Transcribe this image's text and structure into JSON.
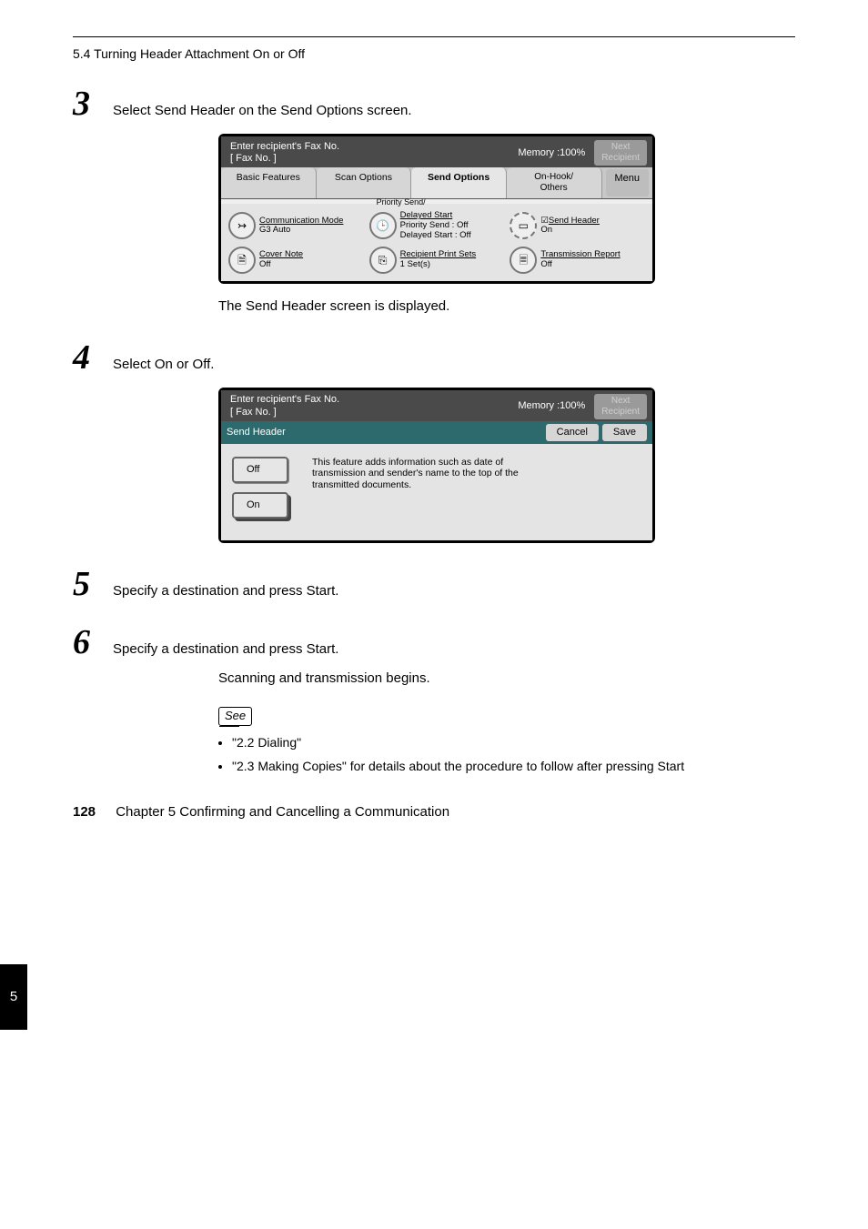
{
  "header": {
    "caption": "5.4 Turning Header Attachment On or Off"
  },
  "steps": {
    "s3": {
      "num": "3",
      "text": "Select Send Header on the Send Options screen.",
      "note": "The Send Header screen is displayed."
    },
    "s4": {
      "num": "4",
      "text": "Select On or Off."
    },
    "s5": {
      "num": "5",
      "text": "Specify a destination and press Start."
    },
    "s6": {
      "num": "6",
      "text": "Specify a destination and press Start.",
      "note": "Scanning and transmission begins."
    }
  },
  "screen1": {
    "title_line1": "Enter recipient's Fax No.",
    "title_line2": "[  Fax No. ]",
    "memory": "Memory :100%",
    "next_l1": "Next",
    "next_l2": "Recipient",
    "tabs": {
      "basic": "Basic Features",
      "scan": "Scan Options",
      "send": "Send Options",
      "hook": "On-Hook/\nOthers",
      "menu": "Menu"
    },
    "priority_title": "Priority Send/",
    "feat": {
      "comm_u": "Communication Mode",
      "comm_s": "G3 Auto",
      "delay_u": "Delayed Start",
      "delay_s1": "Priority Send : Off",
      "delay_s2": "Delayed Start : Off",
      "hdr_u": "Send Header",
      "hdr_s": "On",
      "cover_u": "Cover Note",
      "cover_s": "Off",
      "rps_u": "Recipient Print Sets",
      "rps_s": "1 Set(s)",
      "tr_u": "Transmission Report",
      "tr_s": "Off"
    }
  },
  "screen2": {
    "title_line1": "Enter recipient's Fax No.",
    "title_line2": "[  Fax No. ]",
    "memory": "Memory :100%",
    "next_l1": "Next",
    "next_l2": "Recipient",
    "bar_label": "Send Header",
    "cancel": "Cancel",
    "save": "Save",
    "off": "Off",
    "on": "On",
    "desc": "This feature adds information such as date of transmission and sender's name to the top of the transmitted documents."
  },
  "see": {
    "label": "See",
    "b1": "\"2.2 Dialing\"",
    "b2": "\"2.3 Making Copies\" for details about the procedure to follow after pressing Start"
  },
  "sidebar": {
    "num": "5"
  },
  "footer": {
    "page": "128",
    "chapter": "Chapter 5  Confirming and Cancelling a Communication"
  }
}
